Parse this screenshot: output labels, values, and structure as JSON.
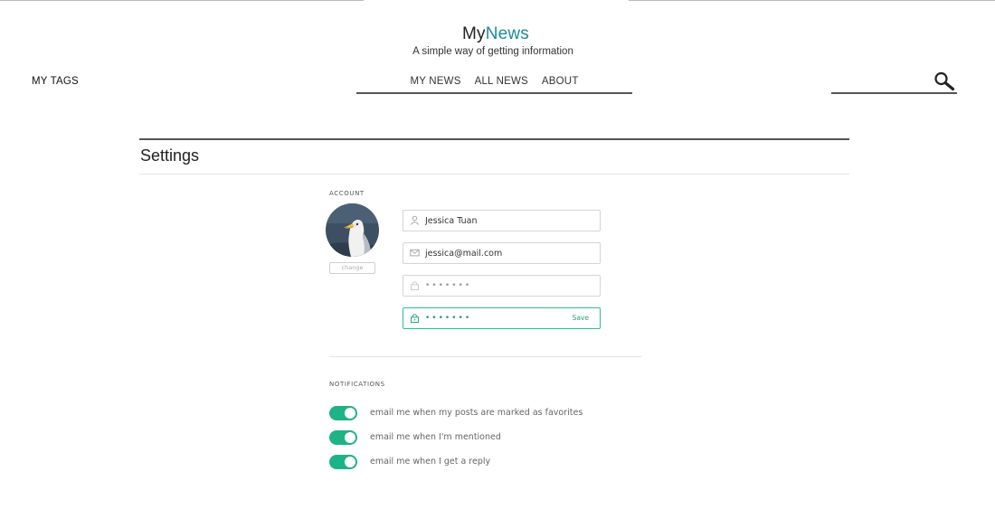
{
  "header": {
    "brand_prefix": "My",
    "brand_accent": "News",
    "tagline": "A simple way of getting information",
    "my_tags": "MY TAGS",
    "nav": [
      {
        "label": "MY NEWS"
      },
      {
        "label": "ALL NEWS"
      },
      {
        "label": "ABOUT"
      }
    ],
    "search": {
      "value": "",
      "icon": "search-icon"
    }
  },
  "page": {
    "title": "Settings"
  },
  "account": {
    "label": "ACCOUNT",
    "avatar_icon": "avatar-seagull",
    "change_label": "change",
    "name": "Jessica Tuan",
    "email": "jessica@mail.com",
    "current_password": "•••••••",
    "new_password": "•••••••",
    "save_label": "Save"
  },
  "notifications": {
    "label": "NOTIFICATIONS",
    "items": [
      {
        "text": "email me when my posts are marked as favorites",
        "enabled": true
      },
      {
        "text": "email me when I'm mentioned",
        "enabled": true
      },
      {
        "text": "email me when I get a reply",
        "enabled": true
      }
    ]
  },
  "colors": {
    "brand_accent": "#1b8c96",
    "toggle_on": "#1eb386",
    "active_field": "#2dbf8f"
  }
}
